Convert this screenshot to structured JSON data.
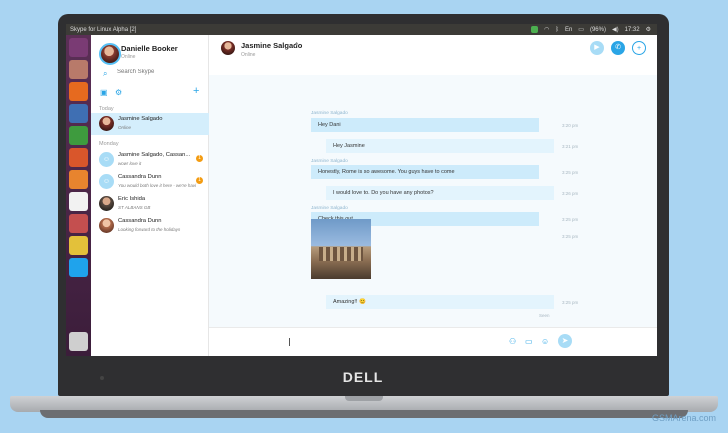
{
  "window": {
    "title": "Skype for Linux Alpha [2]"
  },
  "tray": {
    "battery": "(96%)",
    "clock": "17:32"
  },
  "me": {
    "name": "Danielle Booker",
    "status": "Online"
  },
  "search": {
    "placeholder": "Search Skype"
  },
  "sections": {
    "today": "Today",
    "monday": "Monday"
  },
  "contacts": [
    {
      "name": "Jasmine Salgado",
      "sub": "Online",
      "badge": ""
    },
    {
      "name": "Jasmine Salgado, Cassan...",
      "sub": "wow! love it",
      "badge": "1"
    },
    {
      "name": "Cassandra Dunn",
      "sub": "You would both love it here - we're havi",
      "badge": "1"
    },
    {
      "name": "Eric Ishida",
      "sub": "ST ALBANS GB",
      "badge": ""
    },
    {
      "name": "Cassandra Dunn",
      "sub": "Looking forward to the holidays",
      "badge": ""
    }
  ],
  "chat": {
    "name": "Jasmine Salgado",
    "status": "Online",
    "messages": [
      {
        "sender": "Jasmine Salgado",
        "text": "Hey Dani",
        "time": "3:20 pm"
      },
      {
        "sender": "",
        "text": "Hey Jasmine",
        "time": "3:21 pm"
      },
      {
        "sender": "Jasmine Salgado",
        "text": "Honestly, Rome is so awesome. You guys have to come",
        "time": "3:25 pm"
      },
      {
        "sender": "",
        "text": "I would love to. Do you have any photos?",
        "time": "3:26 pm"
      },
      {
        "sender": "Jasmine Salgado",
        "text": "Check this out ...",
        "time": "3:25 pm"
      },
      {
        "sender": "",
        "text": "",
        "time": "3:25 pm"
      },
      {
        "sender": "",
        "text": "Amazing!! 😊",
        "time": "3:25 pm"
      }
    ],
    "seen": "Seen"
  },
  "laptop": {
    "brand": "DELL"
  },
  "watermark": "GSMArena.com",
  "colors": {
    "accent": "#2aa5e6",
    "bubble": "#cdebfb",
    "launcher": "#4a2548"
  }
}
